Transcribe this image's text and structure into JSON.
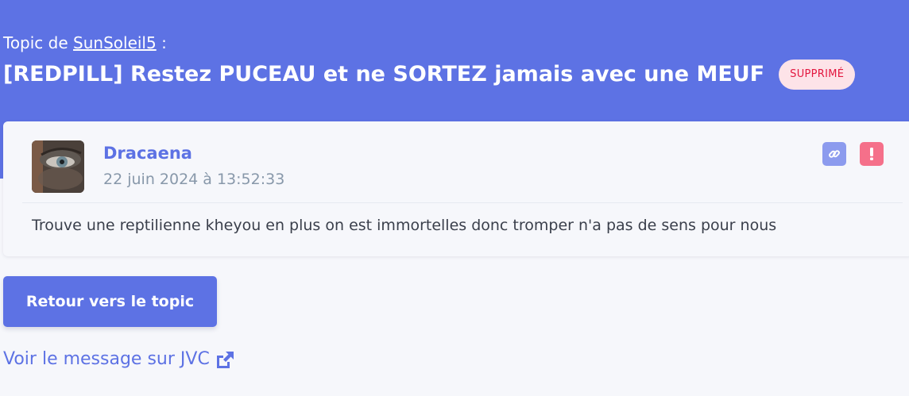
{
  "header": {
    "topic_prefix": "Topic de",
    "author": "SunSoleil5",
    "topic_suffix": " :",
    "title": "[REDPILL] Restez PUCEAU et ne SORTEZ jamais avec une MEUF",
    "badge": "SUPPRIMÉ"
  },
  "post": {
    "username": "Dracaena",
    "timestamp": "22 juin 2024 à 13:52:33",
    "message": "Trouve une reptilienne kheyou en plus on est immortelles donc tromper n'a pas de sens pour nous",
    "icons": [
      "link-icon",
      "exclamation-icon"
    ]
  },
  "actions": {
    "back_label": "Retour vers le topic",
    "jvc_label": "Voir le message sur JVC"
  },
  "colors": {
    "accent": "#5d72e4",
    "badge_bg": "#fde3e8",
    "badge_text": "#e3173f",
    "report": "#f5708a",
    "link_btn": "#8c9bee"
  }
}
